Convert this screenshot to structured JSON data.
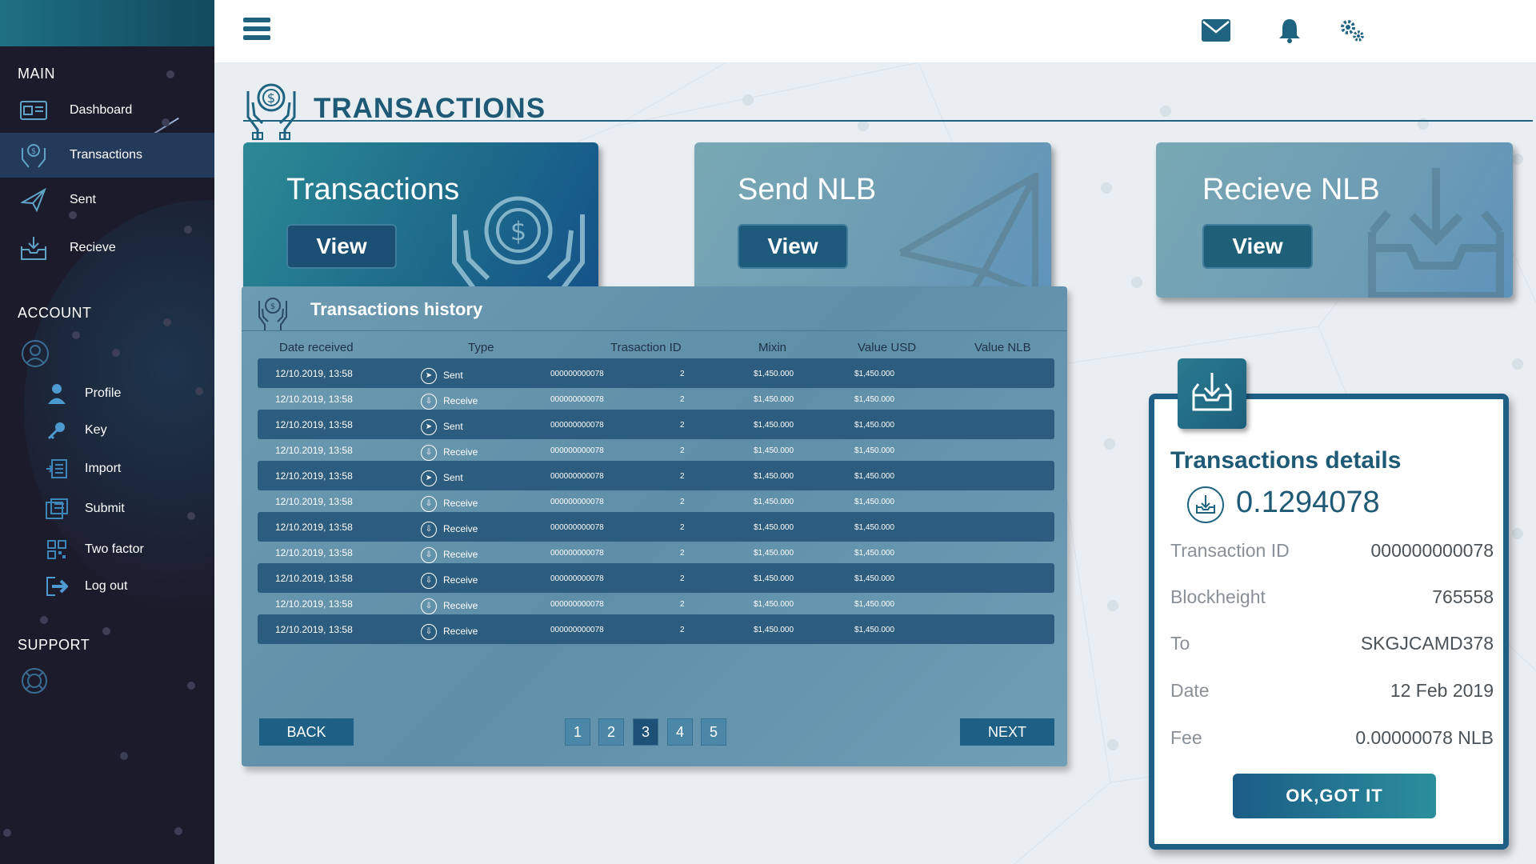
{
  "sidebar": {
    "sections": {
      "main": "MAIN",
      "account": "ACCOUNT",
      "support": "SUPPORT"
    },
    "main_items": [
      {
        "label": "Dashboard",
        "icon": "dashboard-icon"
      },
      {
        "label": "Transactions",
        "icon": "transactions-icon",
        "active": true
      },
      {
        "label": "Sent",
        "icon": "paper-plane-icon"
      },
      {
        "label": "Recieve",
        "icon": "inbox-download-icon"
      }
    ],
    "account_items": [
      {
        "label": "Profile",
        "icon": "user-icon"
      },
      {
        "label": "Key",
        "icon": "key-icon"
      },
      {
        "label": "Import",
        "icon": "import-icon"
      },
      {
        "label": "Submit",
        "icon": "submit-icon"
      },
      {
        "label": "Two factor",
        "icon": "qr-code-icon"
      },
      {
        "label": "Log out",
        "icon": "logout-icon"
      }
    ]
  },
  "header": {
    "title": "TRANSACTIONS"
  },
  "cards": [
    {
      "title": "Transactions",
      "button": "View"
    },
    {
      "title": "Send NLB",
      "button": "View"
    },
    {
      "title": "Recieve NLB",
      "button": "View"
    }
  ],
  "history": {
    "title": "Transactions history",
    "columns": [
      "Date received",
      "Type",
      "Trasaction ID",
      "Mixin",
      "Value USD",
      "Value NLB"
    ],
    "rows": [
      {
        "date": "12/10.2019,  13:58",
        "type": "Sent",
        "id": "000000000078",
        "mixin": "2",
        "usd": "$1,450.000",
        "nlb": "$1,450.000"
      },
      {
        "date": "12/10.2019,  13:58",
        "type": "Receive",
        "id": "000000000078",
        "mixin": "2",
        "usd": "$1,450.000",
        "nlb": "$1,450.000"
      },
      {
        "date": "12/10.2019,  13:58",
        "type": "Sent",
        "id": "000000000078",
        "mixin": "2",
        "usd": "$1,450.000",
        "nlb": "$1,450.000"
      },
      {
        "date": "12/10.2019,  13:58",
        "type": "Receive",
        "id": "000000000078",
        "mixin": "2",
        "usd": "$1,450.000",
        "nlb": "$1,450.000"
      },
      {
        "date": "12/10.2019,  13:58",
        "type": "Sent",
        "id": "000000000078",
        "mixin": "2",
        "usd": "$1,450.000",
        "nlb": "$1,450.000"
      },
      {
        "date": "12/10.2019,  13:58",
        "type": "Receive",
        "id": "000000000078",
        "mixin": "2",
        "usd": "$1,450.000",
        "nlb": "$1,450.000"
      },
      {
        "date": "12/10.2019,  13:58",
        "type": "Receive",
        "id": "000000000078",
        "mixin": "2",
        "usd": "$1,450.000",
        "nlb": "$1,450.000"
      },
      {
        "date": "12/10.2019,  13:58",
        "type": "Receive",
        "id": "000000000078",
        "mixin": "2",
        "usd": "$1,450.000",
        "nlb": "$1,450.000"
      },
      {
        "date": "12/10.2019,  13:58",
        "type": "Receive",
        "id": "000000000078",
        "mixin": "2",
        "usd": "$1,450.000",
        "nlb": "$1,450.000"
      },
      {
        "date": "12/10.2019,  13:58",
        "type": "Receive",
        "id": "000000000078",
        "mixin": "2",
        "usd": "$1,450.000",
        "nlb": "$1,450.000"
      },
      {
        "date": "12/10.2019,  13:58",
        "type": "Receive",
        "id": "000000000078",
        "mixin": "2",
        "usd": "$1,450.000",
        "nlb": "$1,450.000"
      }
    ],
    "pagination": {
      "back": "BACK",
      "next": "NEXT",
      "pages": [
        "1",
        "2",
        "3",
        "4",
        "5"
      ],
      "current": "3"
    }
  },
  "details": {
    "title": "Transactions details",
    "amount": "0.1294078",
    "fields": [
      {
        "key": "Transaction ID",
        "value": "000000000078"
      },
      {
        "key": "Blockheight",
        "value": "765558"
      },
      {
        "key": "To",
        "value": "SKGJCAMD378"
      },
      {
        "key": "Date",
        "value": "12 Feb 2019"
      },
      {
        "key": "Fee",
        "value": "0.00000078 NLB"
      }
    ],
    "button": "OK,GOT IT"
  },
  "colors": {
    "sidebar_bg": "#1c1b2b",
    "accent": "#1e5f85",
    "title_blue": "#1e5a76",
    "teal": "#2b8f9c",
    "page_bg": "#e9eef2"
  }
}
